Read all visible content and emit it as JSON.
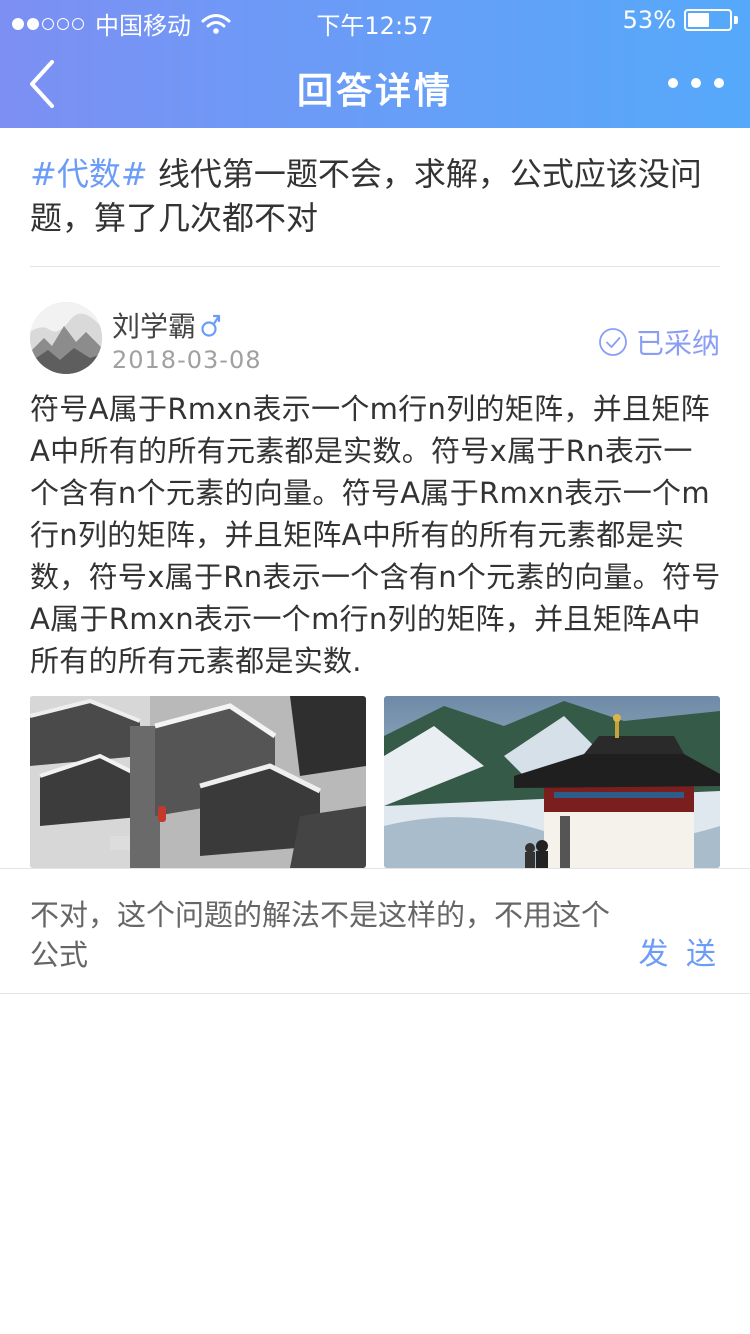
{
  "status_bar": {
    "carrier": "中国移动",
    "time": "下午12:57",
    "battery_percent": "53%",
    "battery_level": 0.53
  },
  "nav": {
    "title": "回答详情",
    "back_icon": "chevron-left-icon",
    "more_icon": "more-horizontal-icon"
  },
  "question": {
    "tag": "#代数#",
    "text": " 线代第一题不会，求解，公式应该没问题，算了几次都不对"
  },
  "answer": {
    "author": "刘学霸",
    "gender_icon": "male-icon",
    "date": "2018-03-08",
    "accepted_label": "已采纳",
    "content": "符号A属于Rmxn表示一个m行n列的矩阵，并且矩阵A中所有的所有元素都是实数。符号x属于Rn表示一个含有n个元素的向量。符号A属于Rmxn表示一个m行n列的矩阵，并且矩阵A中所有的所有元素都是实数，符号x属于Rn表示一个含有n个元素的向量。符号A属于Rmxn表示一个m行n列的矩阵，并且矩阵A中所有的所有元素都是实数."
  },
  "comment_box": {
    "value": "不对，这个问题的解法不是这样的，不用这个公式",
    "send_label": "发 送"
  },
  "colors": {
    "accent": "#6b9cf7",
    "header_start": "#7d8ff3",
    "header_end": "#55a9fa",
    "accepted": "#8a9ff4"
  }
}
